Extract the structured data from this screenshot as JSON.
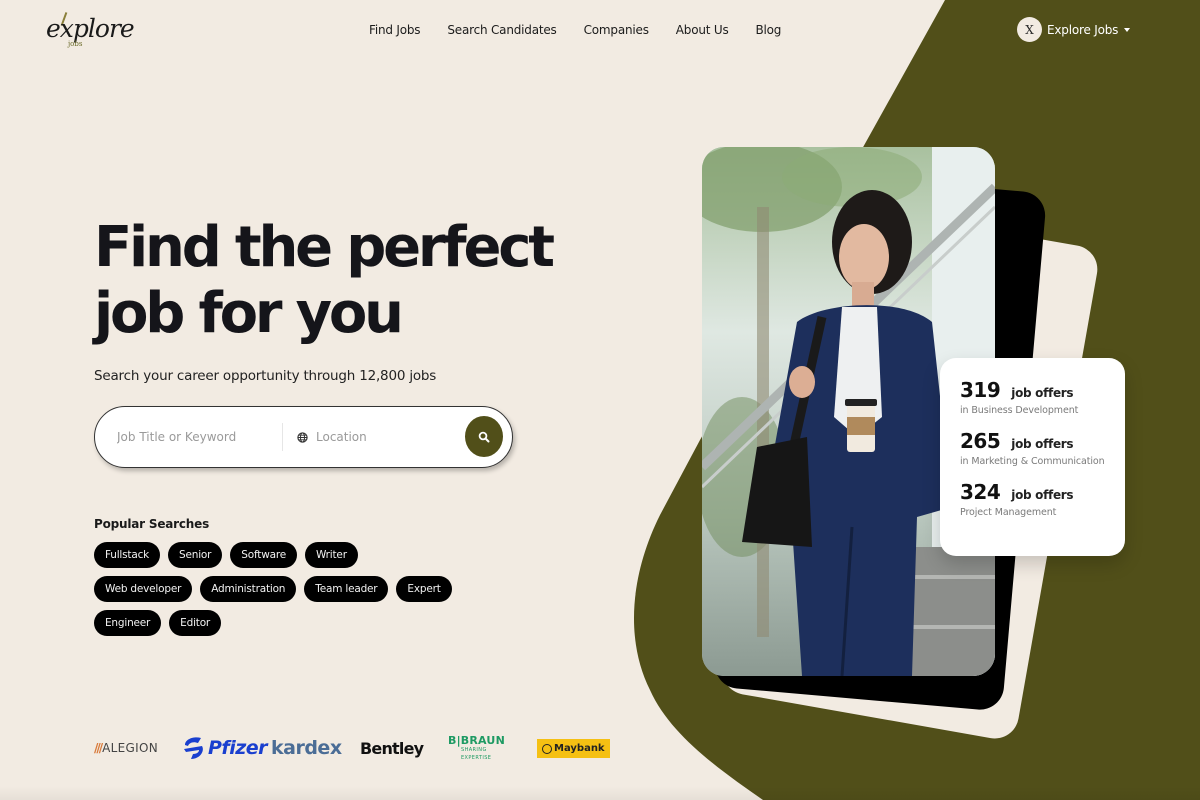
{
  "brand": {
    "logo_text": "explore",
    "logo_sub": "jobs"
  },
  "nav": {
    "items": [
      {
        "label": "Find Jobs"
      },
      {
        "label": "Search Candidates"
      },
      {
        "label": "Companies"
      },
      {
        "label": "About Us"
      },
      {
        "label": "Blog"
      }
    ]
  },
  "account": {
    "avatar_glyph": "X",
    "label": "Explore Jobs",
    "icon": "caret-down-icon"
  },
  "hero": {
    "title_line1": "Find the perfect",
    "title_line2": "job for you",
    "subtitle": "Search your career opportunity through 12,800 jobs"
  },
  "search": {
    "keyword_placeholder": "Job Title or Keyword",
    "keyword_value": "",
    "location_placeholder": "Location",
    "location_value": "",
    "location_icon": "globe-icon",
    "submit_icon": "search-icon"
  },
  "popular": {
    "title": "Popular Searches",
    "tags": [
      "Fullstack",
      "Senior",
      "Software",
      "Writer",
      "Web developer",
      "Administration",
      "Team leader",
      "Expert",
      "Engineer",
      "Editor"
    ]
  },
  "brands": {
    "alegion": "ALEGION",
    "pfizer": "Pfizer",
    "kardex": "kardex",
    "bentley": "Bentley",
    "braun": "B|BRAUN",
    "braun_tagline": "SHARING EXPERTISE",
    "maybank": "Maybank"
  },
  "stats": [
    {
      "number": "319",
      "unit": "job offers",
      "description": "in Business Development"
    },
    {
      "number": "265",
      "unit": "job offers",
      "description": "in Marketing & Communication"
    },
    {
      "number": "324",
      "unit": "job offers",
      "description": "Project Management"
    }
  ],
  "colors": {
    "background": "#f2ebe2",
    "accent_olive": "#514f19",
    "text_dark": "#15151a",
    "chip_bg": "#000000"
  }
}
